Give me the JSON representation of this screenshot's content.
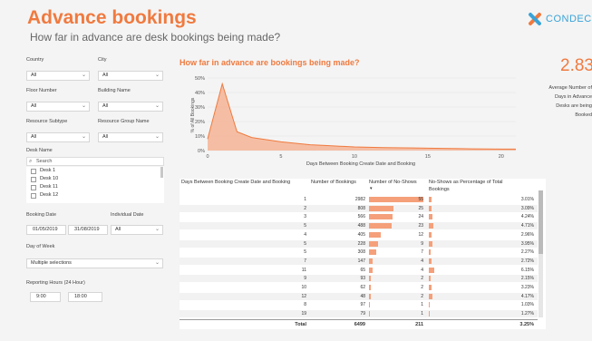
{
  "header": {
    "title": "Advance bookings",
    "subtitle": "How far in advance are desk bookings being made?",
    "logo_text": "CONDECO"
  },
  "filters": {
    "country": {
      "label": "Country",
      "value": "All"
    },
    "city": {
      "label": "City",
      "value": "All"
    },
    "floor": {
      "label": "Floor Number",
      "value": "All"
    },
    "building": {
      "label": "Building Name",
      "value": "All"
    },
    "subtype": {
      "label": "Resource Subtype",
      "value": "All"
    },
    "group": {
      "label": "Resource Group Name",
      "value": "All"
    },
    "desk_name": {
      "label": "Desk Name",
      "search_placeholder": "Search",
      "items": [
        "Desk 1",
        "Desk 10",
        "Desk 11",
        "Desk 12"
      ]
    },
    "booking_date": {
      "label": "Booking Date",
      "from": "01/05/2019",
      "to": "31/08/2019"
    },
    "individual_date": {
      "label": "Individual Date",
      "value": "All"
    },
    "day_of_week": {
      "label": "Day of Week",
      "value": "Multiple selections"
    },
    "hours": {
      "label": "Reporting Hours (24 Hour)",
      "from": "9:00",
      "to": "18:00"
    }
  },
  "kpi": {
    "value": "2.83",
    "label_lines": [
      "Average Number of",
      "Days in Advance",
      "Desks are being",
      "Booked"
    ]
  },
  "chart_data": {
    "type": "area",
    "title": "How far in advance are bookings being made?",
    "xlabel": "Days Between Booking Create Date and Booking",
    "ylabel": "% of All Bookings",
    "x": [
      0,
      1,
      2,
      3,
      4,
      5,
      6,
      7,
      8,
      9,
      10,
      12,
      14,
      16,
      18,
      20,
      21
    ],
    "y": [
      8,
      46,
      13,
      9,
      7.5,
      6,
      5,
      4,
      3.5,
      3,
      2.5,
      2,
      1.8,
      1.5,
      1.2,
      1,
      1
    ],
    "xlim": [
      0,
      21
    ],
    "ylim": [
      0,
      50
    ],
    "yticks": [
      "50%",
      "40%",
      "30%",
      "20%",
      "10%",
      "0%"
    ],
    "xticks": [
      "0",
      "5",
      "10",
      "15",
      "20"
    ],
    "color": "#f07a3f"
  },
  "table": {
    "columns": [
      "Days Between Booking Create Date and Booking",
      "Number of Bookings",
      "Number of No-Shows",
      "No-Shows as Percentage of Total Bookings"
    ],
    "rows": [
      {
        "days": "1",
        "bookings": "2982",
        "noshows": "55",
        "pct": "3.01%",
        "noshow_frac": 1.0,
        "pct_frac": 0.49
      },
      {
        "days": "2",
        "bookings": "808",
        "noshows": "25",
        "pct": "3.09%",
        "noshow_frac": 0.45,
        "pct_frac": 0.5
      },
      {
        "days": "3",
        "bookings": "566",
        "noshows": "24",
        "pct": "4.24%",
        "noshow_frac": 0.44,
        "pct_frac": 0.69
      },
      {
        "days": "5",
        "bookings": "488",
        "noshows": "23",
        "pct": "4.71%",
        "noshow_frac": 0.42,
        "pct_frac": 0.77
      },
      {
        "days": "4",
        "bookings": "405",
        "noshows": "12",
        "pct": "2.96%",
        "noshow_frac": 0.22,
        "pct_frac": 0.48
      },
      {
        "days": "5",
        "bookings": "228",
        "noshows": "9",
        "pct": "3.95%",
        "noshow_frac": 0.16,
        "pct_frac": 0.64
      },
      {
        "days": "5",
        "bookings": "308",
        "noshows": "7",
        "pct": "2.27%",
        "noshow_frac": 0.13,
        "pct_frac": 0.37
      },
      {
        "days": "7",
        "bookings": "147",
        "noshows": "4",
        "pct": "2.72%",
        "noshow_frac": 0.07,
        "pct_frac": 0.44
      },
      {
        "days": "11",
        "bookings": "65",
        "noshows": "4",
        "pct": "6.15%",
        "noshow_frac": 0.07,
        "pct_frac": 1.0
      },
      {
        "days": "9",
        "bookings": "93",
        "noshows": "2",
        "pct": "2.15%",
        "noshow_frac": 0.04,
        "pct_frac": 0.35
      },
      {
        "days": "10",
        "bookings": "62",
        "noshows": "2",
        "pct": "3.23%",
        "noshow_frac": 0.04,
        "pct_frac": 0.52
      },
      {
        "days": "12",
        "bookings": "48",
        "noshows": "2",
        "pct": "4.17%",
        "noshow_frac": 0.04,
        "pct_frac": 0.68
      },
      {
        "days": "8",
        "bookings": "97",
        "noshows": "1",
        "pct": "1.03%",
        "noshow_frac": 0.02,
        "pct_frac": 0.17
      },
      {
        "days": "19",
        "bookings": "79",
        "noshows": "1",
        "pct": "1.27%",
        "noshow_frac": 0.02,
        "pct_frac": 0.21
      }
    ],
    "total": {
      "label": "Total",
      "bookings": "6499",
      "noshows": "211",
      "pct": "3.25%"
    }
  }
}
